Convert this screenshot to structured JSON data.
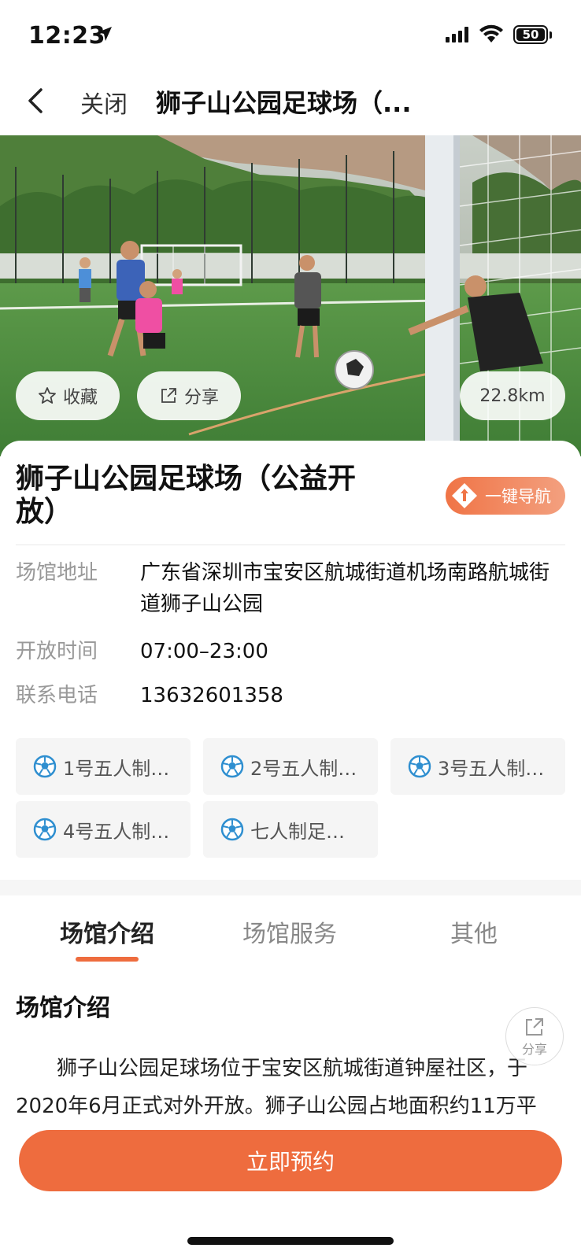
{
  "status_bar": {
    "time": "12:23",
    "battery": "50"
  },
  "nav": {
    "close_label": "关闭",
    "title": "狮子山公园足球场（..."
  },
  "hero": {
    "favorite_label": "收藏",
    "share_label": "分享",
    "distance": "22.8km"
  },
  "venue": {
    "name": "狮子山公园足球场（公益开放）",
    "navigate_label": "一键导航",
    "address_label": "场馆地址",
    "address": "广东省深圳市宝安区航城街道机场南路航城街道狮子山公园",
    "hours_label": "开放时间",
    "hours": "07:00–23:00",
    "phone_label": "联系电话",
    "phone": "13632601358"
  },
  "courts": [
    {
      "label": "1号五人制…",
      "icon": "soccer-ball-icon"
    },
    {
      "label": "2号五人制…",
      "icon": "soccer-ball-icon"
    },
    {
      "label": "3号五人制…",
      "icon": "soccer-ball-icon"
    },
    {
      "label": "4号五人制…",
      "icon": "soccer-ball-icon"
    },
    {
      "label": "七人制足…",
      "icon": "soccer-ball-icon"
    }
  ],
  "tabs": [
    {
      "label": "场馆介绍",
      "active": true
    },
    {
      "label": "场馆服务",
      "active": false
    },
    {
      "label": "其他",
      "active": false
    }
  ],
  "intro": {
    "title": "场馆介绍",
    "text": "狮子山公园足球场位于宝安区航城街道钟屋社区，于2020年6月正式对外开放。狮子山公园占地面积约11万平"
  },
  "float_share_label": "分享",
  "book_button_label": "立即预约",
  "colors": {
    "accent": "#ee6c3e",
    "label_gray": "#999999"
  }
}
